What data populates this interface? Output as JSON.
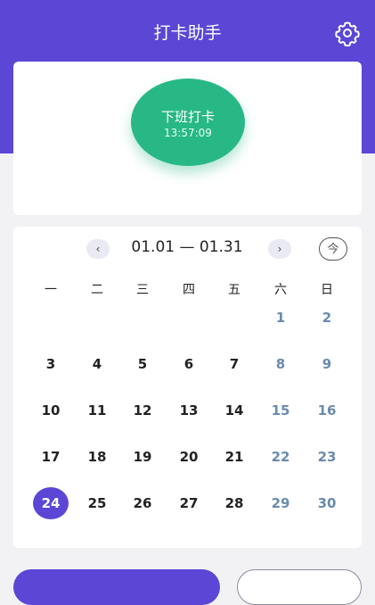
{
  "header": {
    "title": "打卡助手"
  },
  "punch": {
    "label": "下班打卡",
    "time": "13:57:09"
  },
  "calendar": {
    "prev": "‹",
    "next": "›",
    "range": "01.01 — 01.31",
    "today": "今",
    "weekdays": [
      "一",
      "二",
      "三",
      "四",
      "五",
      "六",
      "日"
    ],
    "days": [
      "1",
      "2",
      "3",
      "4",
      "5",
      "6",
      "7",
      "8",
      "9",
      "10",
      "11",
      "12",
      "13",
      "14",
      "15",
      "16",
      "17",
      "18",
      "19",
      "20",
      "21",
      "22",
      "23",
      "24",
      "25",
      "26",
      "27",
      "28",
      "29",
      "30"
    ],
    "selected_day": "24"
  },
  "colors": {
    "primary": "#5b46d6",
    "punch_green": "#28b886",
    "weekend_blue": "#6a8bb0"
  }
}
